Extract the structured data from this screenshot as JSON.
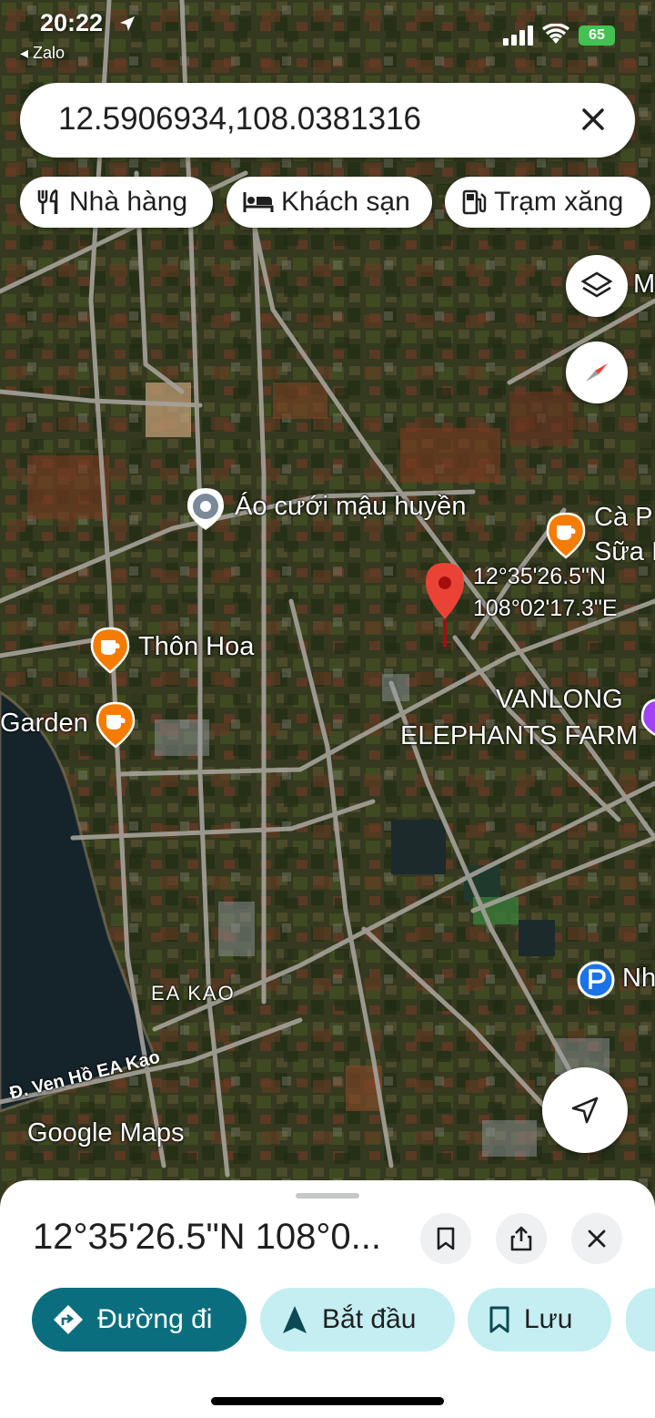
{
  "status_bar": {
    "time": "20:22",
    "back_app": "Zalo",
    "battery": "65"
  },
  "search": {
    "query": "12.5906934,108.0381316"
  },
  "chips": [
    {
      "label": "Nhà hàng",
      "icon": "restaurant-icon"
    },
    {
      "label": "Khách sạn",
      "icon": "hotel-icon"
    },
    {
      "label": "Trạm xăng",
      "icon": "gas-station-icon"
    }
  ],
  "map": {
    "places": {
      "dress_shop": "Áo cưới mậu huyền",
      "cafe_right_line1": "Cà P",
      "cafe_right_line2": "Sữa I",
      "thon_hoa": "Thôn Hoa",
      "garden": "Garden",
      "vanlong_line1": "VANLONG",
      "vanlong_line2": "ELEPHANTS FARM",
      "ea_kao": "EA KAO",
      "road": "Đ. Ven Hồ EA Kao",
      "parking_label": "Nh",
      "layers_label": "M"
    },
    "pin": {
      "lat": "12°35'26.5\"N",
      "lng": "108°02'17.3\"E"
    },
    "logo": {
      "google": "Google",
      "maps": "Maps"
    },
    "colors": {
      "pin": "#ea4335",
      "cafe": "#f57c00",
      "parking": "#1a73e8",
      "attraction": "#a142f4"
    }
  },
  "sheet": {
    "title": "12°35'26.5\"N 108°0...",
    "actions": [
      {
        "label": "Đường đi",
        "icon": "directions-icon"
      },
      {
        "label": "Bắt đầu",
        "icon": "navigation-icon"
      },
      {
        "label": "Lưu",
        "icon": "bookmark-icon"
      }
    ]
  }
}
